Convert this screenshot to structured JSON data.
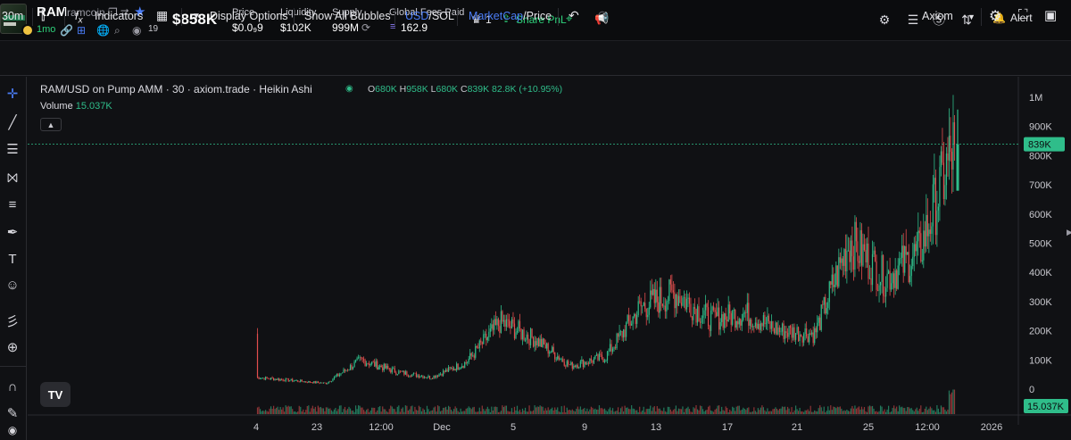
{
  "token": {
    "ticker": "RAM",
    "name": "ramcoin",
    "age": "1mo",
    "viewers": "19",
    "market_cap": "$858K",
    "stats": [
      {
        "label": "Price",
        "value": "$0.0₉9"
      },
      {
        "label": "Liquidity",
        "value": "$102K"
      },
      {
        "label": "Supply",
        "value": "999M"
      },
      {
        "label": "Global Fees Paid",
        "value": "162.9"
      }
    ],
    "crown_count": "1",
    "share_label": "Share PnL",
    "alert_label": "Alert"
  },
  "toolbar": {
    "interval": "30m",
    "indicators": "Indicators",
    "display_options": "Display Options",
    "show_all_bubbles": "Show All Bubbles",
    "usd": "USD",
    "sol": "/SOL",
    "marketcap": "MarketCap",
    "price": "/Price",
    "provider": "Axiom"
  },
  "legend": {
    "title": "RAM/USD on Pump AMM · 30 · axiom.trade · Heikin Ashi",
    "o_label": "O",
    "o": "680K",
    "h_label": "H",
    "h": "958K",
    "l_label": "L",
    "l": "680K",
    "c_label": "C",
    "c": "839K",
    "change": "82.8K (+10.95%)",
    "volume_label": "Volume",
    "volume": "15.037K"
  },
  "colors": {
    "up": "#2fbd8a",
    "down": "#e14d4d",
    "accent": "#3a7bf6",
    "green": "#2fd27c"
  },
  "chart_data": {
    "type": "line",
    "title": "RAM/USD on Pump AMM · 30 · axiom.trade · Heikin Ashi",
    "xlabel": "",
    "ylabel": "",
    "ylim": [
      0,
      1000000
    ],
    "y_ticks": [
      "1M",
      "900K",
      "800K",
      "700K",
      "600K",
      "500K",
      "400K",
      "300K",
      "200K",
      "100K",
      "0"
    ],
    "x_ticks": [
      "4",
      "23",
      "12:00",
      "Dec",
      "5",
      "9",
      "13",
      "17",
      "21",
      "25",
      "12:00",
      "2026"
    ],
    "last_price_label": "839K",
    "last_volume_label": "15.037K",
    "series": [
      {
        "values": [
          {
            "x": "4",
            "y": 40000
          },
          {
            "x": "4",
            "y": 30000
          },
          {
            "x": "23",
            "y": 20000
          },
          {
            "x": "23",
            "y": 100000
          },
          {
            "x": "12:00",
            "y": 60000
          },
          {
            "x": "Dec",
            "y": 40000
          },
          {
            "x": "Dec",
            "y": 90000
          },
          {
            "x": "5",
            "y": 230000
          },
          {
            "x": "5",
            "y": 170000
          },
          {
            "x": "9",
            "y": 80000
          },
          {
            "x": "9",
            "y": 110000
          },
          {
            "x": "13",
            "y": 280000
          },
          {
            "x": "13",
            "y": 330000
          },
          {
            "x": "17",
            "y": 240000
          },
          {
            "x": "21",
            "y": 260000
          },
          {
            "x": "21",
            "y": 200000
          },
          {
            "x": "25",
            "y": 190000
          },
          {
            "x": "25",
            "y": 510000
          },
          {
            "x": "12:00",
            "y": 380000
          },
          {
            "x": "12:00",
            "y": 470000
          },
          {
            "x": "12:00",
            "y": 839000
          }
        ]
      }
    ]
  }
}
